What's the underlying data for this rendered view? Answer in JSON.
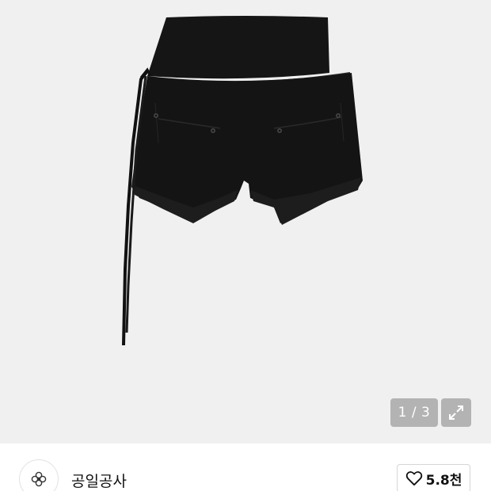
{
  "gallery": {
    "current_page": 1,
    "total_pages": 3,
    "pager_text": "1 / 3",
    "image_subject": "black-shorts-product-photo"
  },
  "seller": {
    "name": "공일공사",
    "avatar_icon": "flower-logo-icon"
  },
  "like": {
    "icon": "heart-outline-icon",
    "count": "5.8천"
  },
  "colors": {
    "hero_background": "#f0f0f0",
    "pager_background": "#8a8a8a",
    "product": "#141414"
  }
}
